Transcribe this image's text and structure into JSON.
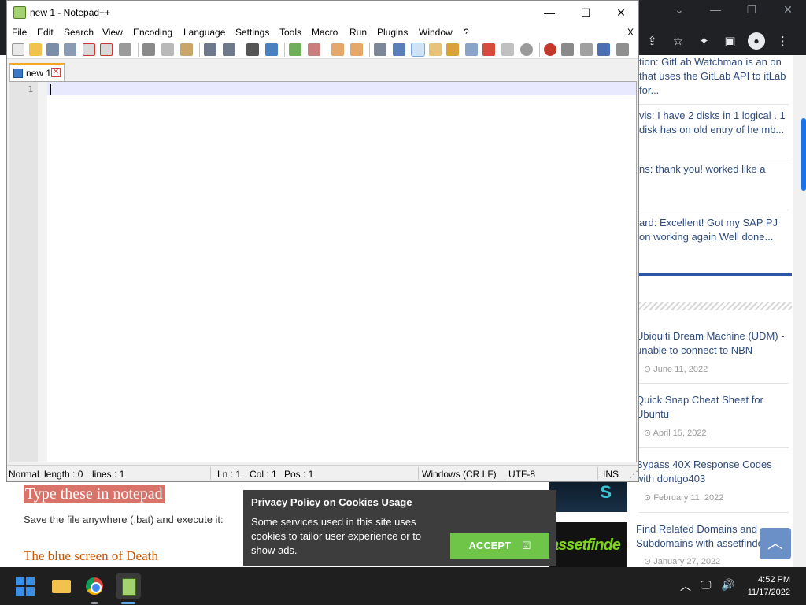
{
  "browser": {
    "window_controls": [
      "⌄",
      "—",
      "❐",
      "✕"
    ],
    "toolbar_icons": [
      "⇪",
      "☆",
      "✦",
      "▣"
    ],
    "avatar_glyph": "●",
    "accent": "#1a73e8"
  },
  "sidebar": {
    "comments": [
      "tion: GitLab Watchman is an on that uses the GitLab API to itLab for...",
      "vis: I have 2 disks in 1 logical . 1 disk has on old entry of he mb...",
      "ns: thank you! worked like a",
      "ard: Excellent! Got my SAP PJ on working again Well done..."
    ],
    "posts": [
      {
        "title": "Ubiquiti Dream Machine (UDM) - unable to connect to NBN",
        "date": "June 11, 2022"
      },
      {
        "title": "Quick Snap Cheat Sheet for Ubuntu",
        "date": "April 15, 2022"
      },
      {
        "title": "Bypass 40X Response Codes with dontgo403",
        "date": "February 11, 2022"
      },
      {
        "title": "Find Related Domains and Subdomains with assetfinder",
        "date": "January 27, 2022"
      }
    ],
    "thumb_texts": [
      "S",
      "assetfinde"
    ]
  },
  "page": {
    "highlight_title": "Type these in notepad",
    "save_text": "Save the file anywhere (.bat) and execute it:",
    "bsod_title": "The blue screen of Death"
  },
  "cookie": {
    "title": "Privacy Policy on Cookies Usage",
    "body": "Some services used in this site uses cookies to tailor user experience or to show ads.",
    "accept_label": "ACCEPT",
    "accept_icon": "☑"
  },
  "back_to_top": "︿",
  "npp": {
    "title": "new 1 - Notepad++",
    "window_buttons": [
      "—",
      "☐",
      "✕"
    ],
    "menu": [
      "File",
      "Edit",
      "Search",
      "View",
      "Encoding",
      "Language",
      "Settings",
      "Tools",
      "Macro",
      "Run",
      "Plugins",
      "Window",
      "?"
    ],
    "menu_close": "X",
    "tab_label": "new 1",
    "tab_close": "✕",
    "line_number": "1",
    "status": {
      "mode": "Normal",
      "length": "length : 0",
      "lines": "lines : 1",
      "ln": "Ln : 1",
      "col": "Col : 1",
      "pos": "Pos : 1",
      "eol": "Windows (CR LF)",
      "encoding": "UTF-8",
      "ins": "INS"
    }
  },
  "taskbar": {
    "tray_icons": [
      "︿",
      "🖵",
      "🔊"
    ],
    "time": "4:52 PM",
    "date": "11/17/2022"
  }
}
